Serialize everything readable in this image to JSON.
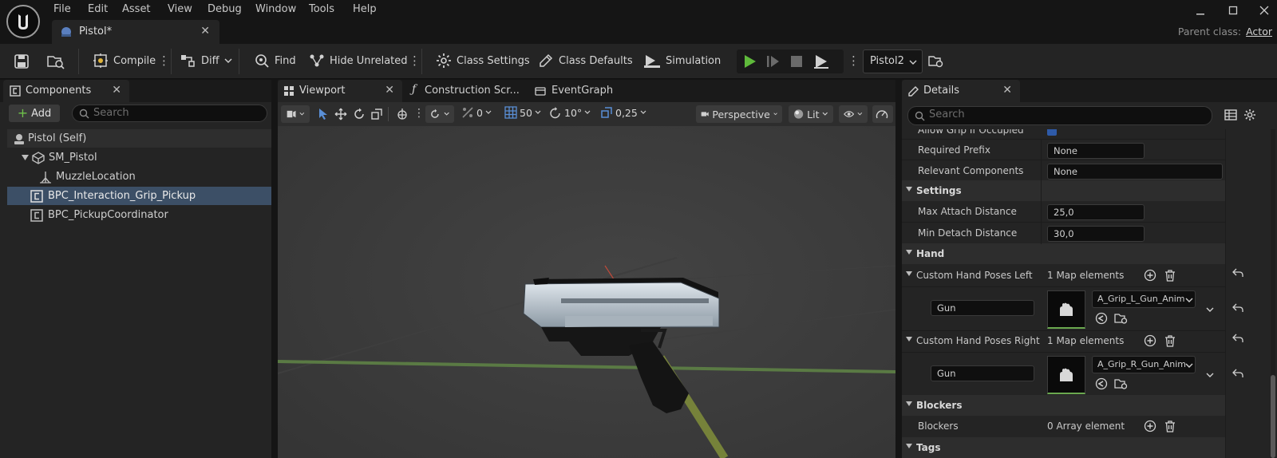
{
  "menu": [
    "File",
    "Edit",
    "Asset",
    "View",
    "Debug",
    "Window",
    "Tools",
    "Help"
  ],
  "document_tab": {
    "title": "Pistol*",
    "close": "✕"
  },
  "parent_class": {
    "label": "Parent class:",
    "value": "Actor"
  },
  "toolbar": {
    "compile": "Compile",
    "diff": "Diff",
    "find": "Find",
    "hide_unrelated": "Hide Unrelated",
    "class_settings": "Class Settings",
    "class_defaults": "Class Defaults",
    "simulation": "Simulation",
    "debug_instance": "Pistol2"
  },
  "components_panel": {
    "tab": "Components",
    "add": "Add",
    "search_placeholder": "Search",
    "items": [
      {
        "label": "Pistol (Self)"
      },
      {
        "label": "SM_Pistol"
      },
      {
        "label": "MuzzleLocation"
      },
      {
        "label": "BPC_Interaction_Grip_Pickup"
      },
      {
        "label": "BPC_PickupCoordinator"
      }
    ]
  },
  "center_tabs": [
    {
      "label": "Viewport"
    },
    {
      "label": "Construction Scr..."
    },
    {
      "label": "EventGraph"
    }
  ],
  "viewport_toolbar": {
    "translate_snap": "0",
    "grid_snap": "50",
    "rotate_snap": "10°",
    "scale_snap": "0,25",
    "view_mode": "Perspective",
    "lighting": "Lit"
  },
  "details_panel": {
    "tab": "Details",
    "search_placeholder": "Search",
    "cut_off_row": "Allow Grip If Occupied",
    "rows": {
      "required_prefix": {
        "label": "Required Prefix",
        "value": "None"
      },
      "relevant_components": {
        "label": "Relevant Components",
        "value": "None"
      },
      "settings_section": "Settings",
      "max_attach": {
        "label": "Max Attach Distance",
        "value": "25,0"
      },
      "min_detach": {
        "label": "Min Detach Distance",
        "value": "30,0"
      },
      "hand_section": "Hand",
      "poses_left": {
        "label": "Custom Hand Poses Left",
        "value": "1 Map elements",
        "key": "Gun",
        "anim": "A_Grip_L_Gun_Anim"
      },
      "poses_right": {
        "label": "Custom Hand Poses Right",
        "value": "1 Map elements",
        "key": "Gun",
        "anim": "A_Grip_R_Gun_Anim"
      },
      "blockers_section": "Blockers",
      "blockers": {
        "label": "Blockers",
        "value": "0 Array element"
      },
      "tags_section": "Tags"
    }
  },
  "colors": {
    "accent_selection": "#3c4f66",
    "play_green": "#5fba3b",
    "panel_bg": "#242424",
    "input_bg": "#0f0f0f"
  }
}
